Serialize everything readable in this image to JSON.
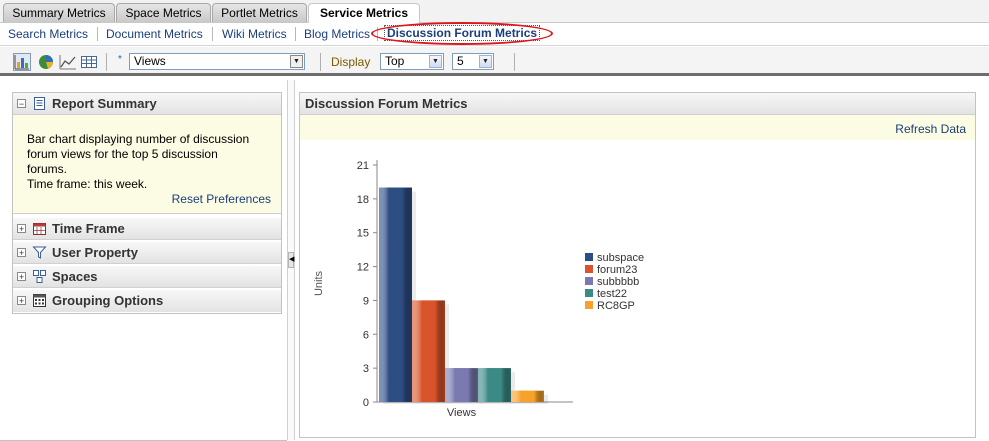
{
  "top_tabs": [
    "Summary Metrics",
    "Space Metrics",
    "Portlet Metrics",
    "Service Metrics"
  ],
  "sub_tabs": [
    "Search Metrics",
    "Document Metrics",
    "Wiki Metrics",
    "Blog Metrics",
    "Discussion Forum Metrics"
  ],
  "toolbar": {
    "asterisk": "*",
    "metric_select": "Views",
    "display_label": "Display",
    "display_select": "Top",
    "count_select": "5"
  },
  "left": {
    "report_summary": "Report Summary",
    "summary_lines": [
      "Bar chart displaying number of discussion",
      "forum views for the top 5 discussion",
      "forums.",
      "Time frame: this week."
    ],
    "reset": "Reset Preferences",
    "sections": [
      "Time Frame",
      "User Property",
      "Spaces",
      "Grouping Options"
    ]
  },
  "right": {
    "title": "Discussion Forum Metrics",
    "refresh": "Refresh Data"
  },
  "chart_data": {
    "type": "bar",
    "title": "",
    "xlabel": "Views",
    "ylabel": "Units",
    "ylim": [
      0,
      21
    ],
    "yticks": [
      0,
      3,
      6,
      9,
      12,
      15,
      18,
      21
    ],
    "categories": [
      "Views"
    ],
    "series": [
      {
        "name": "subspace",
        "values": [
          19
        ],
        "color": "#2e4d82"
      },
      {
        "name": "forum23",
        "values": [
          9
        ],
        "color": "#d9542a"
      },
      {
        "name": "subbbbb",
        "values": [
          3
        ],
        "color": "#7a7ab0"
      },
      {
        "name": "test22",
        "values": [
          3
        ],
        "color": "#3b8a86"
      },
      {
        "name": "RC8GP",
        "values": [
          1
        ],
        "color": "#f7a12b"
      }
    ],
    "legend": "right",
    "grid": false
  }
}
